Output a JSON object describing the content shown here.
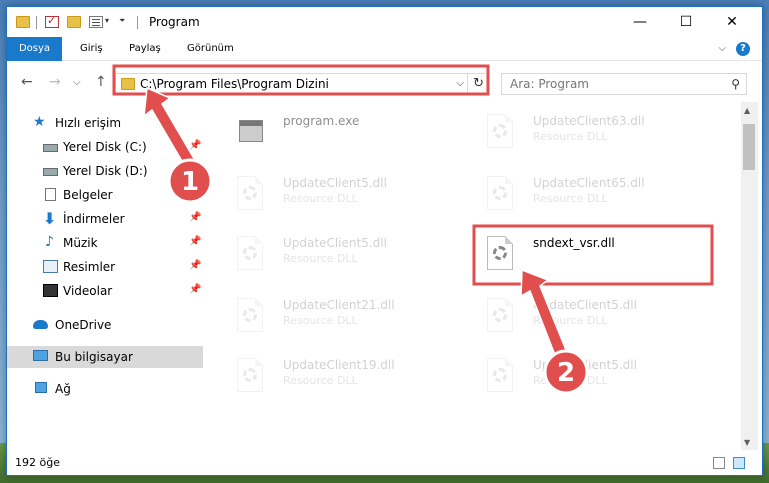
{
  "window": {
    "title": "Program",
    "minimize_glyph": "—",
    "maximize_glyph": "☐",
    "close_glyph": "✕"
  },
  "ribbon": {
    "tabs": [
      {
        "label": "Dosya"
      },
      {
        "label": "Giriş"
      },
      {
        "label": "Paylaş"
      },
      {
        "label": "Görünüm"
      }
    ],
    "collapse_glyph": "⌵",
    "help_glyph": "?"
  },
  "navigation": {
    "back_glyph": "←",
    "forward_glyph": "→",
    "recent_glyph": "⌵",
    "up_glyph": "↑",
    "address": "C:\\Program Files\\Program Dizini",
    "address_dropdown_glyph": "⌵",
    "refresh_glyph": "↻",
    "search_placeholder": "Ara: Program",
    "search_glyph": "⚲"
  },
  "sidebar": {
    "pin_glyph": "📌",
    "items": [
      {
        "label": "Hızlı erişim",
        "icon": "star-icon",
        "glyph": "★"
      },
      {
        "label": "Yerel Disk (C:)",
        "icon": "disk-icon"
      },
      {
        "label": "Yerel Disk (D:)",
        "icon": "disk-icon"
      },
      {
        "label": "Belgeler",
        "icon": "document-icon"
      },
      {
        "label": "İndirmeler",
        "icon": "download-icon",
        "glyph": "⬇"
      },
      {
        "label": "Müzik",
        "icon": "music-icon",
        "glyph": "♪"
      },
      {
        "label": "Resimler",
        "icon": "pictures-icon"
      },
      {
        "label": "Videolar",
        "icon": "video-icon"
      },
      {
        "label": "OneDrive",
        "icon": "cloud-icon"
      },
      {
        "label": "Bu bilgisayar",
        "icon": "computer-icon"
      },
      {
        "label": "Ağ",
        "icon": "network-icon"
      }
    ]
  },
  "files": [
    {
      "name": "program.exe",
      "type": ""
    },
    {
      "name": "UpdateClient63.dll",
      "type": "Resource DLL"
    },
    {
      "name": "UpdateClient5.dll",
      "type": "Resource DLL"
    },
    {
      "name": "UpdateClient65.dll",
      "type": "Resource DLL"
    },
    {
      "name": "UpdateClient5.dll",
      "type": "Resource DLL"
    },
    {
      "name": "sndext_vsr.dll",
      "type": ""
    },
    {
      "name": "UpdateClient21.dll",
      "type": "Resource DLL"
    },
    {
      "name": "UpdateClient5.dll",
      "type": "Resource DLL"
    },
    {
      "name": "UpdateClient19.dll",
      "type": "Resource DLL"
    },
    {
      "name": "UpdateClient5.dll",
      "type": "Resource DLL"
    }
  ],
  "status": {
    "item_count": "192 öğe"
  },
  "annotations": {
    "step1": "1",
    "step2": "2",
    "color": "#e04e4e"
  }
}
